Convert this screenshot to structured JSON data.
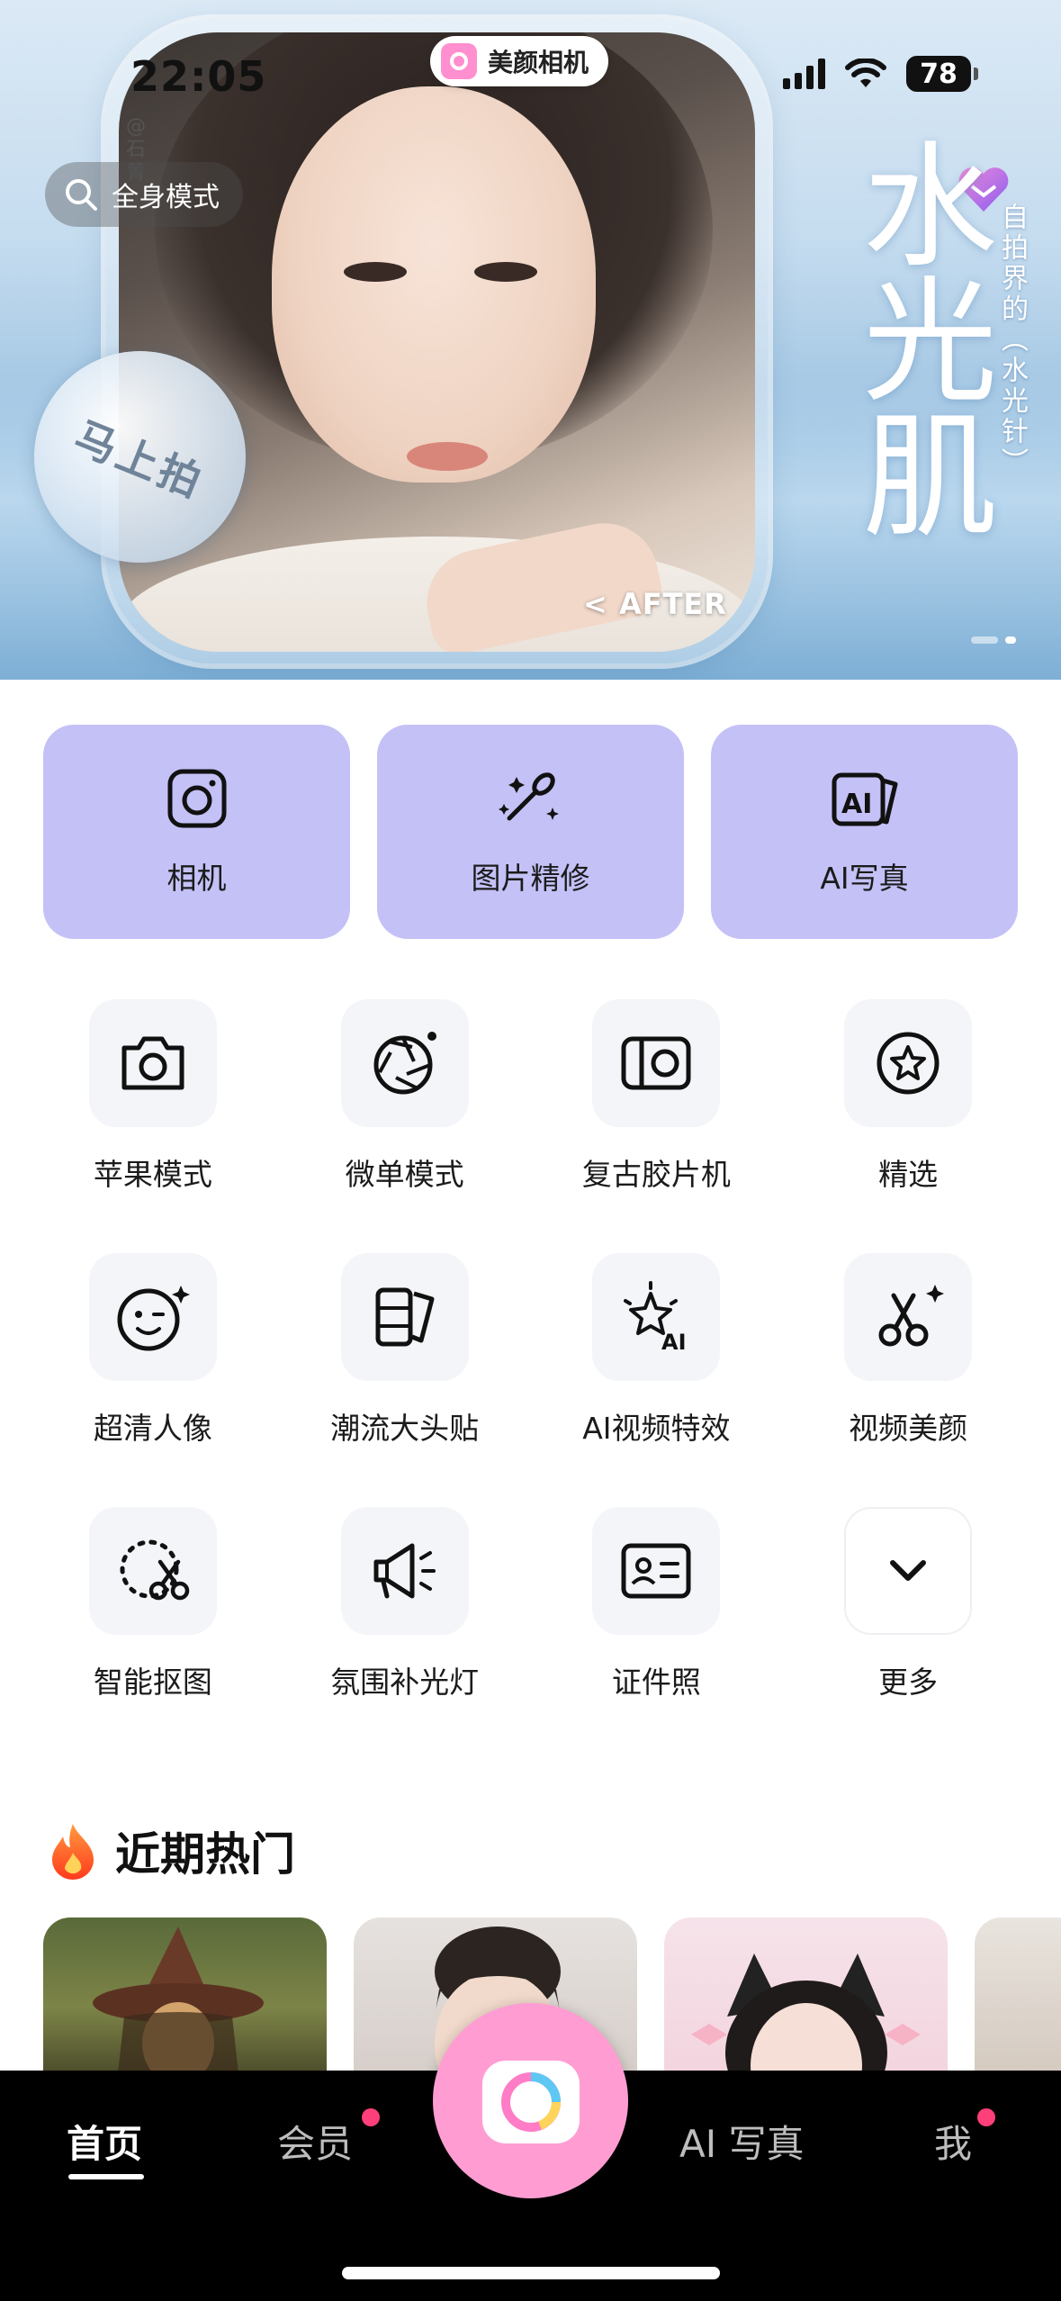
{
  "status_bar": {
    "time": "22:05",
    "battery": "78"
  },
  "banner": {
    "app_name": "美颜相机",
    "search_mode": "全身模式",
    "credit": "@石菁",
    "shoot_now": "马上拍",
    "after_label": "< AFTER",
    "title": "水光肌",
    "subtitle": "自拍界的（水光针）"
  },
  "feature_cards": [
    {
      "label": "相机",
      "icon": "camera-icon"
    },
    {
      "label": "图片精修",
      "icon": "retouch-icon"
    },
    {
      "label": "AI写真",
      "icon": "ai-portrait-icon"
    }
  ],
  "tools": [
    {
      "label": "苹果模式",
      "icon": "camera-icon"
    },
    {
      "label": "微单模式",
      "icon": "aperture-icon"
    },
    {
      "label": "复古胶片机",
      "icon": "film-camera-icon"
    },
    {
      "label": "精选",
      "icon": "star-icon"
    },
    {
      "label": "超清人像",
      "icon": "smile-icon"
    },
    {
      "label": "潮流大头贴",
      "icon": "photo-sticker-icon"
    },
    {
      "label": "AI视频特效",
      "icon": "ai-sparkle-icon"
    },
    {
      "label": "视频美颜",
      "icon": "scissors-sparkle-icon"
    },
    {
      "label": "智能抠图",
      "icon": "cutout-icon"
    },
    {
      "label": "氛围补光灯",
      "icon": "megaphone-icon"
    },
    {
      "label": "证件照",
      "icon": "id-card-icon"
    },
    {
      "label": "更多",
      "icon": "chevron-down-icon"
    }
  ],
  "hot": {
    "title": "近期热门",
    "icon": "fire-icon"
  },
  "bottom_nav": {
    "home": "首页",
    "vip": "会员",
    "ai_portrait": "AI 写真",
    "me": "我"
  },
  "colors": {
    "card_bg": "#c4c1f7",
    "shutter": "#ff9dd3",
    "badge": "#ff3f7a",
    "nav_bg": "#000000"
  }
}
